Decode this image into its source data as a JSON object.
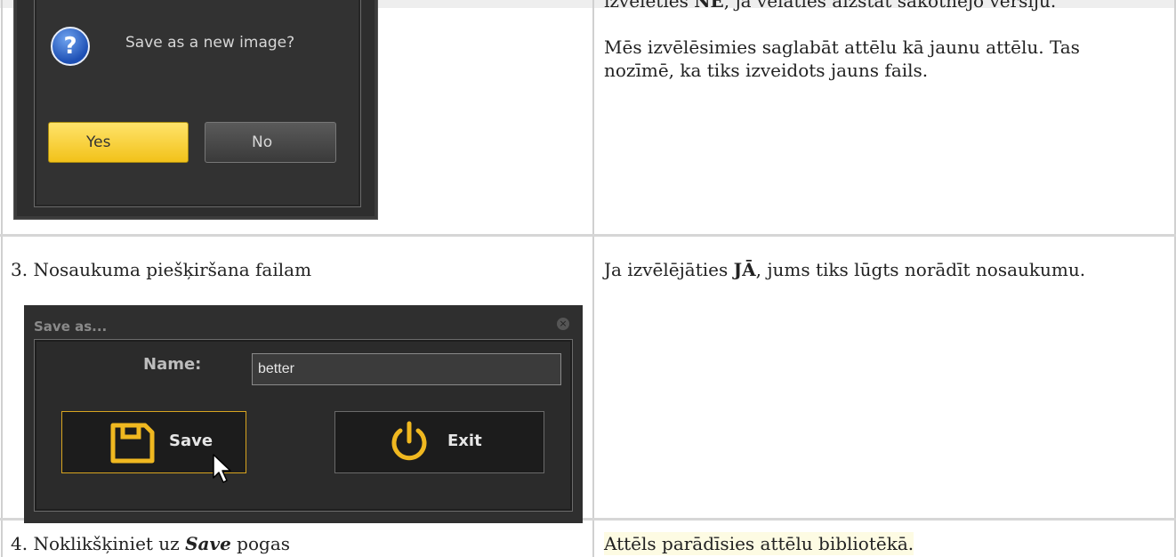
{
  "top_cell": {
    "cut_line_html": "izvēlēties <b>NĒ</b>, ja vēlaties aizstāt sākotnējo versiju.",
    "paragraph": "Mēs izvēlēsimies saglabāt attēlu kā jaunu attēlu. Tas nozīmē, ka tiks izveidots jauns fails."
  },
  "confirm_dialog": {
    "icon": "question-icon",
    "question": "Save as a new image?",
    "yes_label": "Yes",
    "no_label": "No",
    "accent": "#f2c21a"
  },
  "step3": {
    "title": "3. Nosaukuma piešķiršana failam",
    "description_pre": "Ja izvēlējāties ",
    "description_bold": "JĀ",
    "description_post": ", jums tiks lūgts norādīt nosaukumu."
  },
  "save_dialog": {
    "title": "Save as...",
    "close_icon": "close-icon",
    "name_label": "Name:",
    "name_value": "better",
    "save_label": "Save",
    "exit_label": "Exit",
    "save_icon": "floppy-disk-icon",
    "exit_icon": "power-icon"
  },
  "step4": {
    "title_pre": "4. Noklikšķiniet uz ",
    "title_bold": "Save",
    "title_post": " pogas",
    "description": "Attēls parādīsies attēlu bibliotēkā."
  }
}
